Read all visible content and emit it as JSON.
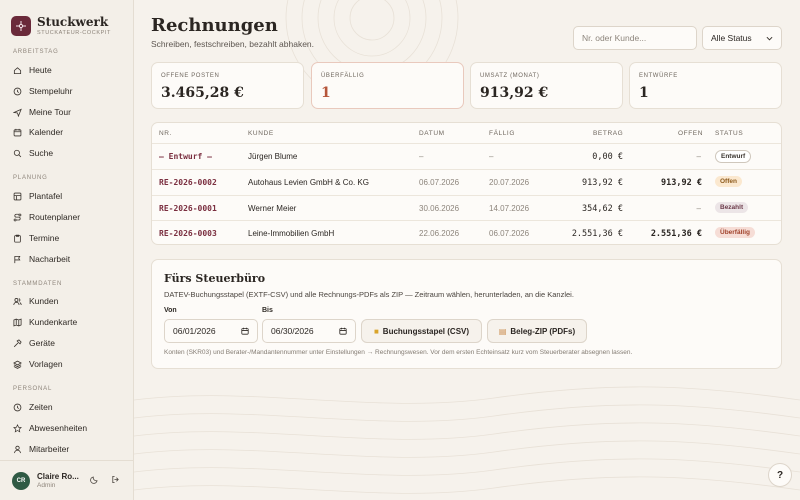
{
  "brand": {
    "name": "Stuckwerk",
    "subtitle": "STUCKATEUR-COCKPIT"
  },
  "sidebar": {
    "sections": [
      {
        "label": "ARBEITSTAG",
        "items": [
          {
            "label": "Heute",
            "icon": "home-icon"
          },
          {
            "label": "Stempeluhr",
            "icon": "clock-icon"
          },
          {
            "label": "Meine Tour",
            "icon": "send-icon"
          },
          {
            "label": "Kalender",
            "icon": "calendar-icon"
          },
          {
            "label": "Suche",
            "icon": "search-icon"
          }
        ]
      },
      {
        "label": "PLANUNG",
        "items": [
          {
            "label": "Plantafel",
            "icon": "grid-icon"
          },
          {
            "label": "Routenplaner",
            "icon": "route-icon"
          },
          {
            "label": "Termine",
            "icon": "clipboard-icon"
          },
          {
            "label": "Nacharbeit",
            "icon": "flag-icon"
          }
        ]
      },
      {
        "label": "STAMMDATEN",
        "items": [
          {
            "label": "Kunden",
            "icon": "users-icon"
          },
          {
            "label": "Kundenkarte",
            "icon": "map-icon"
          },
          {
            "label": "Geräte",
            "icon": "hammer-icon"
          },
          {
            "label": "Vorlagen",
            "icon": "layers-icon"
          }
        ]
      },
      {
        "label": "PERSONAL",
        "items": [
          {
            "label": "Zeiten",
            "icon": "clock-icon"
          },
          {
            "label": "Abwesenheiten",
            "icon": "star-icon"
          },
          {
            "label": "Mitarbeiter",
            "icon": "user-icon"
          }
        ]
      }
    ],
    "user": {
      "initials": "CR",
      "name": "Claire Ro...",
      "role": "Admin"
    }
  },
  "header": {
    "title": "Rechnungen",
    "subtitle": "Schreiben, festschreiben, bezahlt abhaken.",
    "search_placeholder": "Nr. oder Kunde...",
    "status_filter": "Alle Status"
  },
  "kpis": [
    {
      "label": "OFFENE POSTEN",
      "value": "3.465,28 €"
    },
    {
      "label": "ÜBERFÄLLIG",
      "value": "1"
    },
    {
      "label": "UMSATZ (MONAT)",
      "value": "913,92 €"
    },
    {
      "label": "ENTWÜRFE",
      "value": "1"
    }
  ],
  "table": {
    "columns": [
      "NR.",
      "KUNDE",
      "DATUM",
      "FÄLLIG",
      "BETRAG",
      "OFFEN",
      "STATUS"
    ],
    "rows": [
      {
        "nr": "— Entwurf —",
        "kunde": "Jürgen Blume",
        "datum": "–",
        "faellig": "–",
        "betrag": "0,00 €",
        "offen": "–",
        "status": "Entwurf",
        "status_type": "draft"
      },
      {
        "nr": "RE-2026-0002",
        "kunde": "Autohaus Levien GmbH & Co. KG",
        "datum": "06.07.2026",
        "faellig": "20.07.2026",
        "betrag": "913,92 €",
        "offen": "913,92 €",
        "status": "Offen",
        "status_type": "open"
      },
      {
        "nr": "RE-2026-0001",
        "kunde": "Werner Meier",
        "datum": "30.06.2026",
        "faellig": "14.07.2026",
        "betrag": "354,62 €",
        "offen": "–",
        "status": "Bezahlt",
        "status_type": "paid"
      },
      {
        "nr": "RE-2026-0003",
        "kunde": "Leine-Immobilien GmbH",
        "datum": "22.06.2026",
        "faellig": "06.07.2026",
        "betrag": "2.551,36 €",
        "offen": "2.551,36 €",
        "status": "Überfällig",
        "status_type": "overdue"
      }
    ]
  },
  "tax": {
    "title": "Fürs Steuerbüro",
    "description": "DATEV-Buchungsstapel (EXTF-CSV) und alle Rechnungs-PDFs als ZIP — Zeitraum wählen, herunterladen, an die Kanzlei.",
    "from_label": "Von",
    "from_value": "06/01/2026",
    "to_label": "Bis",
    "to_value": "06/30/2026",
    "csv_button": "Buchungsstapel (CSV)",
    "zip_button": "Beleg-ZIP (PDFs)",
    "note": "Konten (SKR03) und Berater-/Mandantennummer unter Einstellungen → Rechnungswesen. Vor dem ersten Echteinsatz kurz vom Steuerberater absegnen lassen."
  },
  "help": {
    "label": "?"
  }
}
